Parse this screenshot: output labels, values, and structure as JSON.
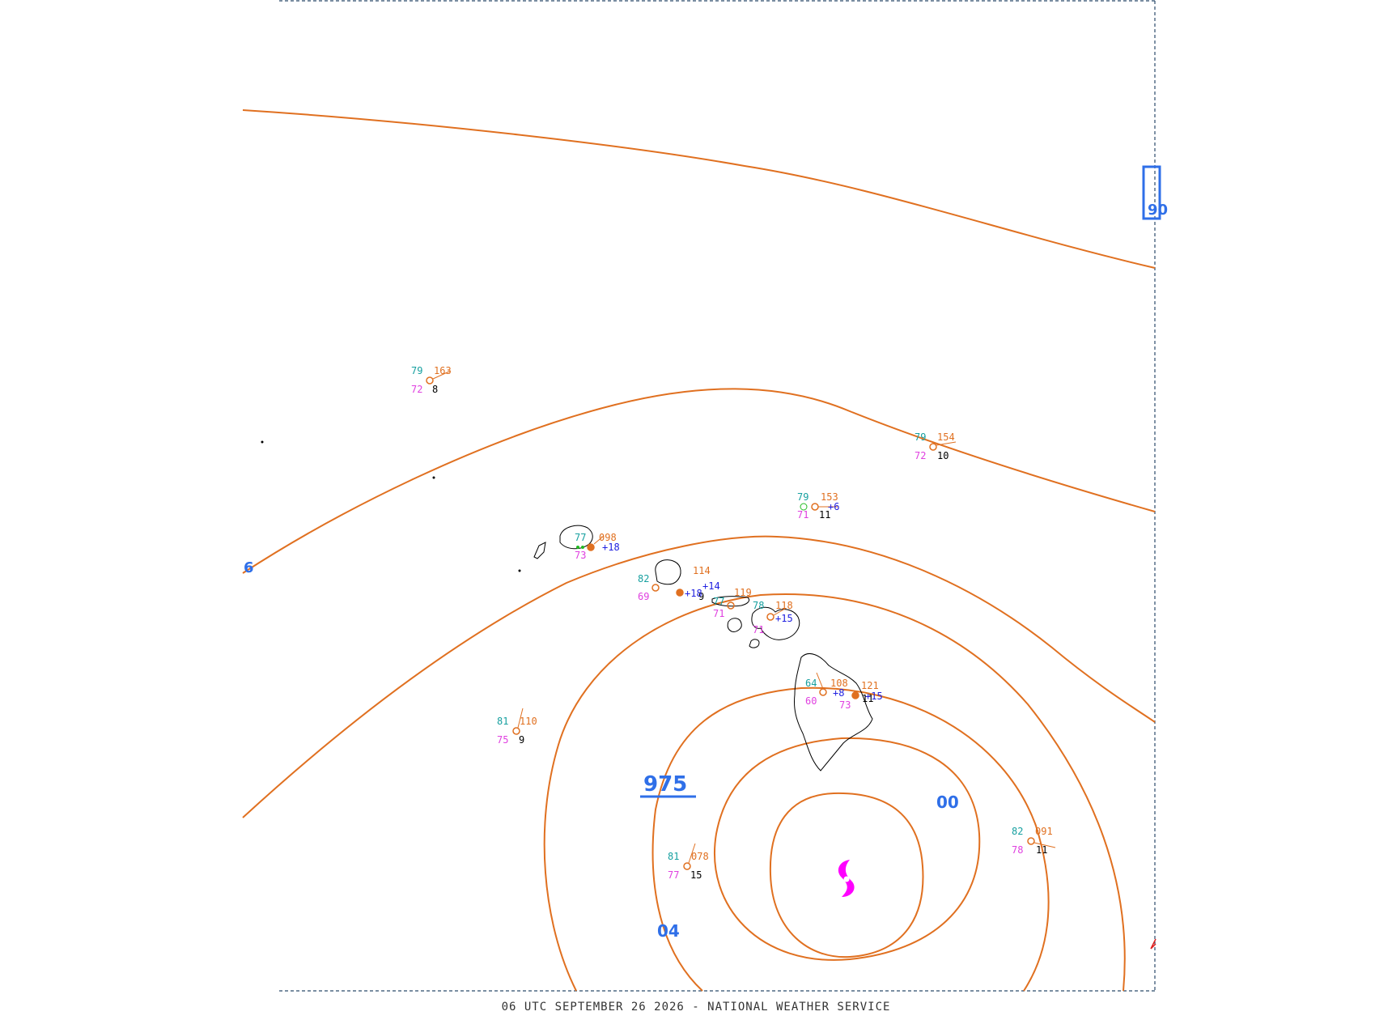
{
  "map": {
    "footer": "06 UTC SEPTEMBER 26 2026 - NATIONAL WEATHER SERVICE",
    "colors": {
      "isobar": "#e07020",
      "isobar_label": "#2f6fe8",
      "temperature": "#17a0a0",
      "dewpoint": "#e040e0",
      "pressure": "#e07020",
      "tendency": "#2020e0",
      "visibility": "#000000",
      "hurricane_symbol": "#ff00ff",
      "coastline": "#000000",
      "border": "#2b4a6a"
    },
    "isobar_labels": [
      {
        "text": "6"
      },
      {
        "text": "90"
      },
      {
        "text": "975"
      },
      {
        "text": "00"
      },
      {
        "text": "04"
      }
    ],
    "hurricane": {
      "symbol": "hurricane-icon"
    },
    "stations": [
      {
        "temp": "79",
        "dew": "72",
        "pressure": "163",
        "vis": "8",
        "tend": ""
      },
      {
        "temp": "79",
        "dew": "72",
        "pressure": "154",
        "vis": "10",
        "tend": ""
      },
      {
        "temp": "79",
        "dew": "71",
        "pressure": "153",
        "vis": "11",
        "tend": "+6"
      },
      {
        "temp": "77",
        "dew": "73",
        "pressure": "098",
        "vis": "",
        "tend": "+18"
      },
      {
        "temp": "82",
        "dew": "69",
        "pressure": "114",
        "vis": "9",
        "tend": "+14"
      },
      {
        "temp": "77",
        "dew": "71",
        "pressure": "119",
        "vis": "",
        "tend": "+18"
      },
      {
        "temp": "78",
        "dew": "71",
        "pressure": "118",
        "vis": "",
        "tend": "+15"
      },
      {
        "temp": "64",
        "dew": "60",
        "pressure": "108",
        "vis": "",
        "tend": "+8"
      },
      {
        "temp": "",
        "dew": "73",
        "pressure": "121",
        "vis": "11",
        "tend": "+15"
      },
      {
        "temp": "81",
        "dew": "75",
        "pressure": "110",
        "vis": "9",
        "tend": ""
      },
      {
        "temp": "81",
        "dew": "77",
        "pressure": "078",
        "vis": "15",
        "tend": ""
      },
      {
        "temp": "82",
        "dew": "78",
        "pressure": "091",
        "vis": "11",
        "tend": ""
      }
    ]
  }
}
